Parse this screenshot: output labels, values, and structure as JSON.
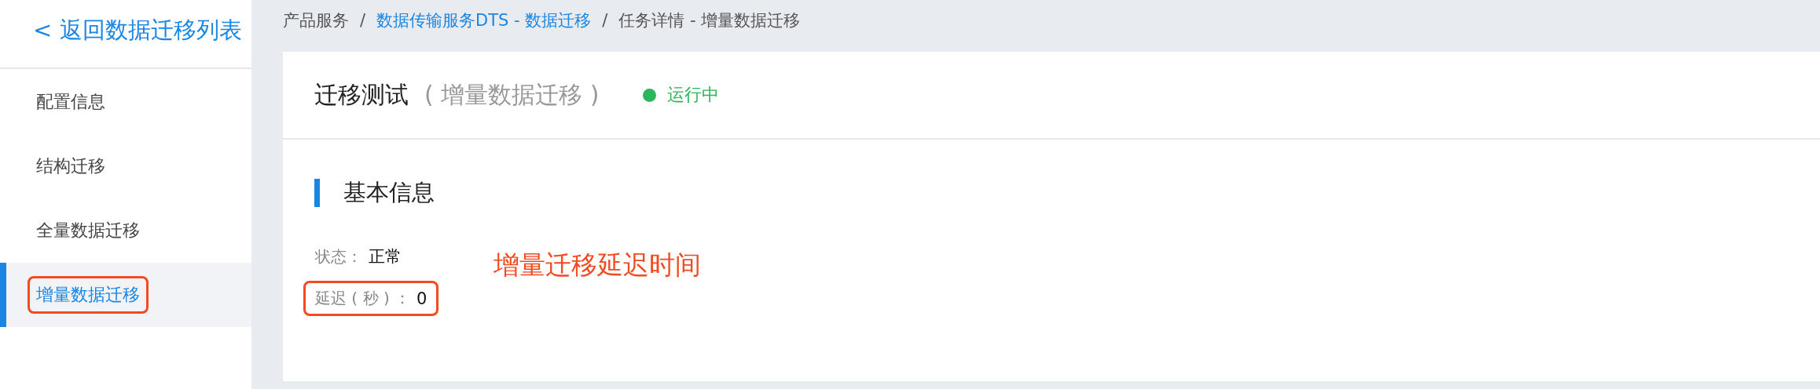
{
  "sidebar": {
    "back_link": "< 返回数据迁移列表",
    "items": [
      {
        "label": "配置信息",
        "selected": false,
        "highlighted": false
      },
      {
        "label": "结构迁移",
        "selected": false,
        "highlighted": false
      },
      {
        "label": "全量数据迁移",
        "selected": false,
        "highlighted": false
      },
      {
        "label": "增量数据迁移",
        "selected": true,
        "highlighted": true
      }
    ]
  },
  "breadcrumb": [
    {
      "label": "产品服务",
      "link": false
    },
    {
      "label": "数据传输服务DTS - 数据迁移",
      "link": true
    },
    {
      "label": "任务详情 - 增量数据迁移",
      "link": false
    }
  ],
  "breadcrumb_separator": "/",
  "header": {
    "title": "迁移测试",
    "subtitle": "( 增量数据迁移 )",
    "status": {
      "label": "运行中",
      "color": "#2db55d"
    }
  },
  "section": {
    "title": "基本信息",
    "fields": [
      {
        "label": "状态：",
        "value": "正常",
        "highlighted": false
      },
      {
        "label": "延迟 ( 秒 ) ：",
        "value": "0",
        "highlighted": true
      }
    ]
  },
  "annotation": "增量迁移延迟时间"
}
